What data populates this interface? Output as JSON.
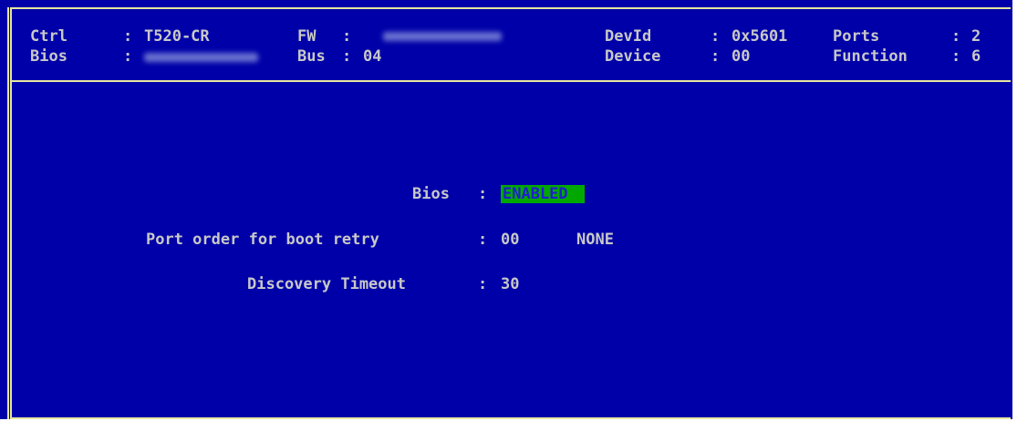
{
  "header": {
    "ctrl_label": "Ctrl",
    "ctrl_sep": ":",
    "ctrl_value": "T520-CR",
    "bios_label": "Bios",
    "bios_sep": ":",
    "fw_label": "FW",
    "fw_sep": ":",
    "bus_label": "Bus",
    "bus_sep": ":",
    "bus_value": "04",
    "devid_label": "DevId",
    "devid_sep": ":",
    "devid_value": "0x5601",
    "device_label": "Device",
    "device_sep": ":",
    "device_value": "00",
    "ports_label": "Ports",
    "ports_sep": ":",
    "ports_value": "2",
    "function_label": "Function",
    "function_sep": ":",
    "function_value": "6"
  },
  "settings": {
    "bios": {
      "label": "Bios",
      "sep": ":",
      "value": "ENABLED"
    },
    "port_order": {
      "label": "Port order for boot retry",
      "sep": ":",
      "value": "00",
      "extra": "NONE"
    },
    "discovery_timeout": {
      "label": "Discovery Timeout",
      "sep": ":",
      "value": "30"
    }
  },
  "colors": {
    "background": "#0000a8",
    "frame": "#e6e6a0",
    "text": "#c8c8c8",
    "highlight_bg": "#00a800",
    "highlight_text": "#1f1fd0"
  }
}
